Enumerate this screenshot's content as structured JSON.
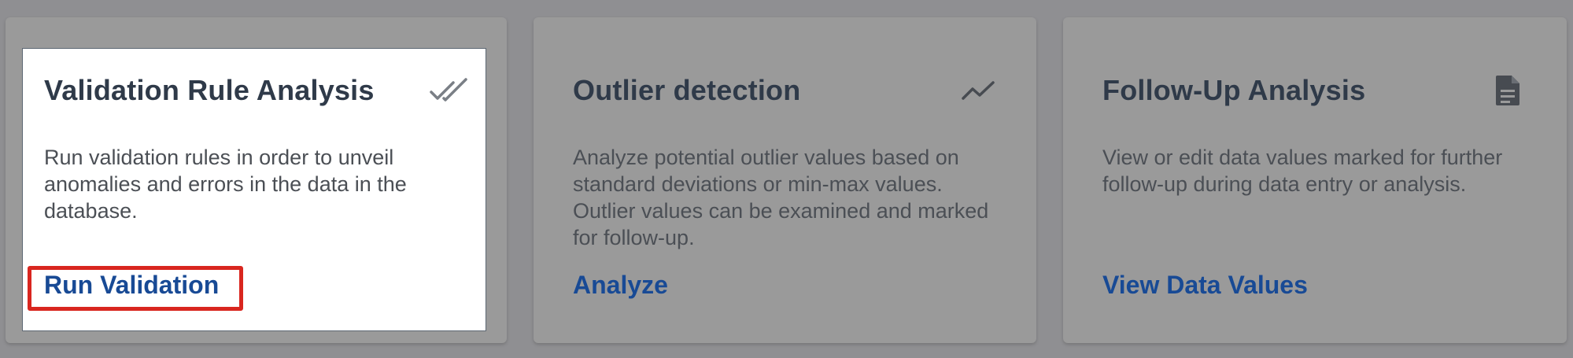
{
  "cards": [
    {
      "title": "Validation Rule Analysis",
      "icon": "double-check-icon",
      "description": "Run validation rules in order to unveil anomalies and errors in the data in the database.",
      "action_label": "Run Validation"
    },
    {
      "title": "Outlier detection",
      "icon": "trending-line-icon",
      "description": "Analyze potential outlier values based on standard deviations or min-max values. Outlier values can be examined and marked for follow-up.",
      "action_label": "Analyze"
    },
    {
      "title": "Follow-Up Analysis",
      "icon": "document-icon",
      "description": "View or edit data values marked for further follow-up during data entry or analysis.",
      "action_label": "View Data Values"
    }
  ],
  "colors": {
    "overlay": "#8f8f92",
    "card_dimmed": "#9a9a9a",
    "highlight_bg": "#ffffff",
    "title": "#28384c",
    "link_active": "#1460c5",
    "link_dimmed": "#184a95",
    "callout_border": "#d9261f"
  }
}
